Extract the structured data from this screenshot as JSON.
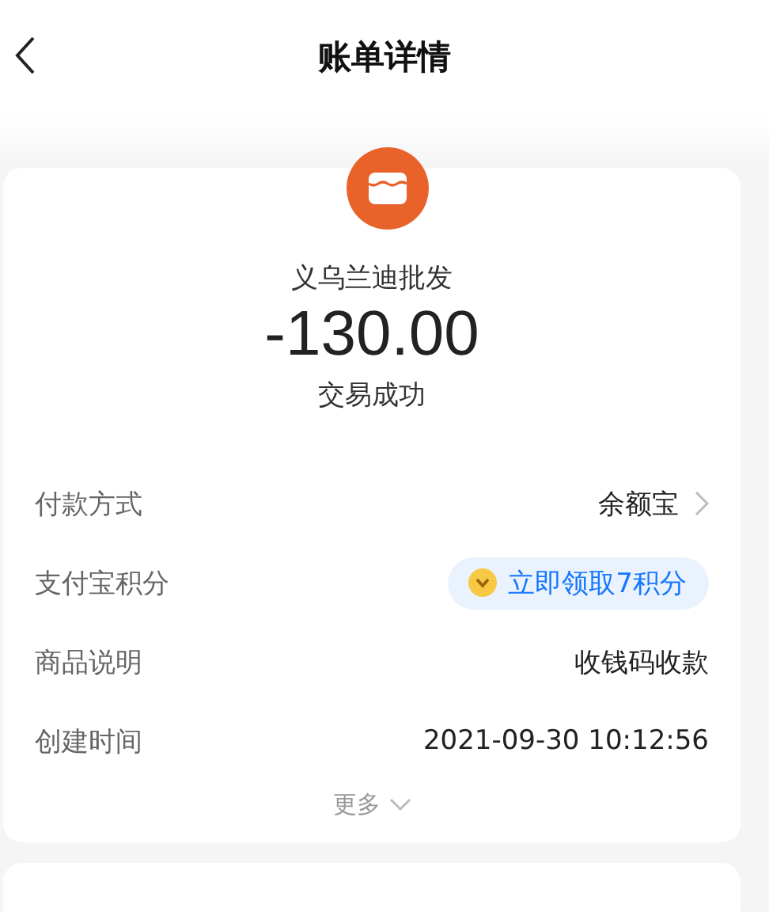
{
  "header": {
    "title": "账单详情"
  },
  "bill": {
    "merchant": "义乌兰迪批发",
    "amount": "-130.00",
    "status": "交易成功"
  },
  "rows": [
    {
      "kind": "link",
      "label": "付款方式",
      "value": "余额宝"
    },
    {
      "kind": "badge",
      "label": "支付宝积分",
      "value": "立即领取7积分"
    },
    {
      "kind": "text",
      "label": "商品说明",
      "value": "收钱码收款"
    },
    {
      "kind": "text",
      "label": "创建时间",
      "value": "2021-09-30 10:12:56"
    }
  ],
  "more": "更多"
}
